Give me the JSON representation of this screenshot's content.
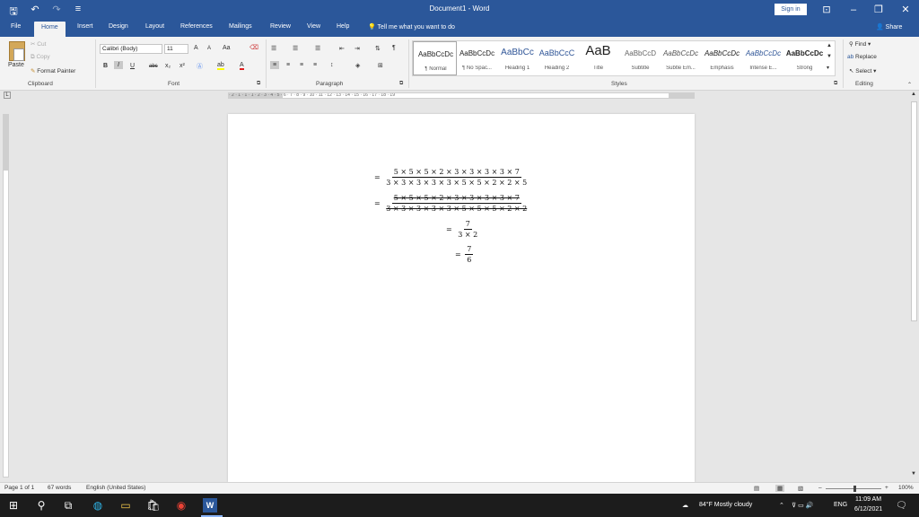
{
  "titlebar": {
    "title": "Document1  -  Word",
    "sign_in": "Sign in",
    "colors": {
      "brand": "#2b579a"
    }
  },
  "tabs": [
    {
      "label": "File"
    },
    {
      "label": "Home"
    },
    {
      "label": "Insert"
    },
    {
      "label": "Design"
    },
    {
      "label": "Layout"
    },
    {
      "label": "References"
    },
    {
      "label": "Mailings"
    },
    {
      "label": "Review"
    },
    {
      "label": "View"
    },
    {
      "label": "Help"
    }
  ],
  "tell_me": "Tell me what you want to do",
  "share": "Share",
  "clipboard": {
    "paste": "Paste",
    "cut": "Cut",
    "copy": "Copy",
    "format_painter": "Format Painter",
    "label": "Clipboard"
  },
  "font": {
    "name": "Calibri (Body)",
    "size": "11",
    "label": "Font",
    "grow": "A",
    "shrink": "A",
    "change_case": "Aa",
    "bold": "B",
    "italic": "I",
    "underline": "U",
    "strike": "abc",
    "subscript": "x₂",
    "superscript": "x²"
  },
  "paragraph": {
    "label": "Paragraph",
    "pilcrow": "¶"
  },
  "styles": {
    "label": "Styles",
    "items": [
      {
        "sample": "AaBbCcDc",
        "name": "¶ Normal"
      },
      {
        "sample": "AaBbCcDc",
        "name": "¶ No Spac..."
      },
      {
        "sample": "AaBbCc",
        "name": "Heading 1"
      },
      {
        "sample": "AaBbCcC",
        "name": "Heading 2"
      },
      {
        "sample": "AaB",
        "name": "Title"
      },
      {
        "sample": "AaBbCcD",
        "name": "Subtitle"
      },
      {
        "sample": "AaBbCcDc",
        "name": "Subtle Em..."
      },
      {
        "sample": "AaBbCcDc",
        "name": "Emphasis"
      },
      {
        "sample": "AaBbCcDc",
        "name": "Intense E..."
      },
      {
        "sample": "AaBbCcDc",
        "name": "Strong"
      }
    ]
  },
  "editing": {
    "find": "Find",
    "replace": "Replace",
    "select": "Select",
    "label": "Editing"
  },
  "ruler": {
    "marks": "· 2 · 1 · 1 · 1 · 2 · 3 · 4 · 5 · 6 · 7 · 8 · 9 · 10 · 11 · 12 · 13 · 14 · 15 · 16 · 17 · 18 · 19"
  },
  "document": {
    "line1": {
      "num": "5 × 5 × 5 × 2 × 3 × 3 × 3 × 3 × 7",
      "den": "3 × 3 × 3 × 3 × 3 × 5 × 5 × 2 × 2 × 5"
    },
    "line2": {
      "num": "5 × 5 × 5 × 2 × 3 × 3 × 3 × 3 × 7",
      "den": "3 × 3 × 3 × 3 × 3 × 5 × 5 × 5 × 2 × 2"
    },
    "line3": {
      "num": "7",
      "den": "3 × 2"
    },
    "line4": {
      "num": "7",
      "den": "6"
    },
    "equals": "="
  },
  "status": {
    "page": "Page 1 of 1",
    "words": "67 words",
    "language": "English (United States)",
    "zoom": "100%"
  },
  "taskbar": {
    "weather": "84°F  Mostly cloudy",
    "lang": "ENG",
    "time": "11:09 AM",
    "date": "6/12/2021"
  }
}
